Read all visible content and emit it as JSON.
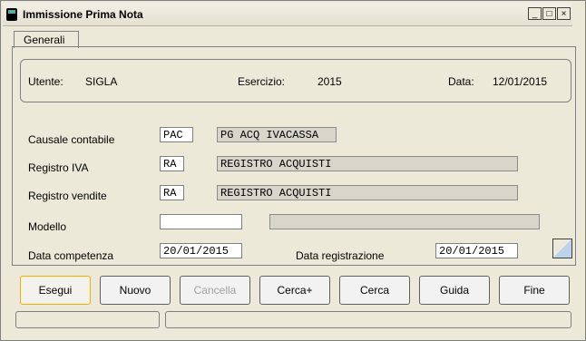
{
  "window": {
    "title": "Immissione Prima Nota",
    "controls": [
      "_",
      "□",
      "×"
    ]
  },
  "tabs": [
    {
      "label": "Generali"
    }
  ],
  "header": {
    "user_label": "Utente:",
    "user_value": "SIGLA",
    "year_label": "Esercizio:",
    "year_value": "2015",
    "date_label": "Data:",
    "date_value": "12/01/2015"
  },
  "form": {
    "causale_label": "Causale contabile",
    "causale_code": "PAC",
    "causale_desc": "PG ACQ IVACASSA",
    "registro_iva_label": "Registro IVA",
    "registro_iva_code": "RA",
    "registro_iva_desc": "REGISTRO ACQUISTI",
    "registro_vendite_label": "Registro vendite",
    "registro_vendite_code": "RA",
    "registro_vendite_desc": "REGISTRO ACQUISTI",
    "modello_label": "Modello",
    "modello_code": "",
    "modello_desc": "",
    "data_competenza_label": "Data competenza",
    "data_competenza_value": "20/01/2015",
    "data_registrazione_label": "Data registrazione",
    "data_registrazione_value": "20/01/2015"
  },
  "buttons": {
    "esegui": "Esegui",
    "nuovo": "Nuovo",
    "cancella": "Cancella",
    "cerca_plus": "Cerca+",
    "cerca": "Cerca",
    "guida": "Guida",
    "fine": "Fine"
  },
  "status": {
    "left": "",
    "right": ""
  }
}
